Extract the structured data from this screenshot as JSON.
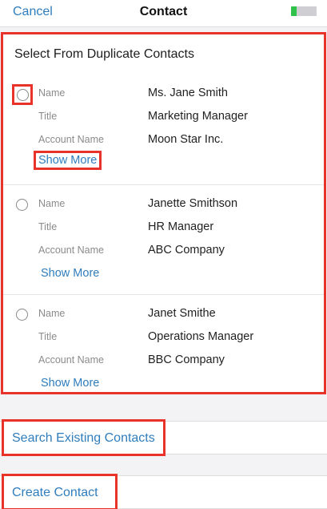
{
  "header": {
    "cancel_label": "Cancel",
    "title": "Contact",
    "battery_level_percent": 22
  },
  "duplicates": {
    "heading": "Select From Duplicate Contacts",
    "field_labels": {
      "name": "Name",
      "title": "Title",
      "account": "Account Name"
    },
    "contacts": [
      {
        "name": "Ms. Jane Smith",
        "title": "Marketing Manager",
        "account": "Moon Star Inc.",
        "show_more": "Show More"
      },
      {
        "name": "Janette Smithson",
        "title": "HR Manager",
        "account": "ABC Company",
        "show_more": "Show More"
      },
      {
        "name": "Janet Smithe",
        "title": "Operations Manager",
        "account": "BBC Company",
        "show_more": "Show More"
      }
    ]
  },
  "actions": {
    "search_existing": "Search Existing Contacts",
    "create_contact": "Create Contact"
  },
  "colors": {
    "accent_link": "#2f7dbd",
    "highlight_border": "#e8322a",
    "battery_fill": "#2fc24a"
  }
}
